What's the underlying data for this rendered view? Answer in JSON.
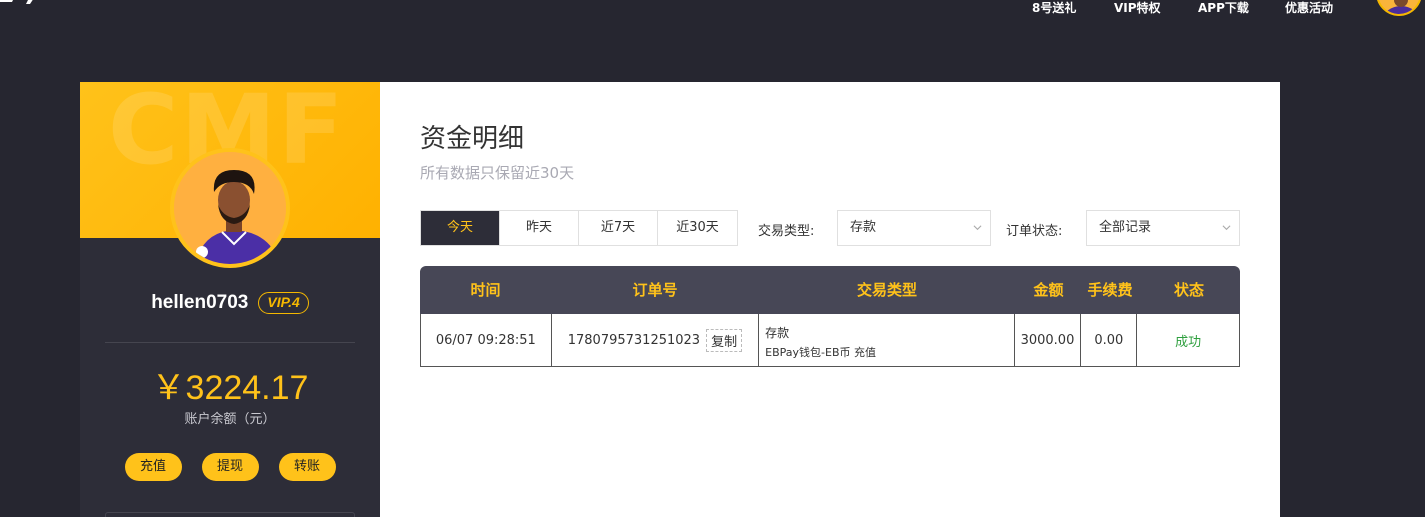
{
  "nav": {
    "items": [
      "8号送礼",
      "VIP特权",
      "APP下载",
      "优惠活动"
    ]
  },
  "profile": {
    "banner_text": "CMF",
    "username": "hellen0703",
    "vip_label": "VIP.4",
    "balance": "￥3224.17",
    "balance_label": "账户余额（元）",
    "buttons": [
      "充值",
      "提现",
      "转账"
    ]
  },
  "main": {
    "title": "资金明细",
    "subtitle": "所有数据只保留近30天",
    "date_tabs": [
      {
        "label": "今天",
        "active": true
      },
      {
        "label": "昨天",
        "active": false
      },
      {
        "label": "近7天",
        "active": false
      },
      {
        "label": "近30天",
        "active": false
      }
    ],
    "filter_type_label": "交易类型:",
    "filter_type_value": "存款",
    "filter_status_label": "订单状态:",
    "filter_status_value": "全部记录"
  },
  "table": {
    "headers": [
      "时间",
      "订单号",
      "交易类型",
      "金额",
      "手续费",
      "状态"
    ],
    "rows": [
      {
        "time": "06/07 09:28:51",
        "order_no": "1780795731251023",
        "copy_label": "复制",
        "type_main": "存款",
        "type_sub": "EBPay钱包-EB币 充值",
        "amount": "3000.00",
        "fee": "0.00",
        "status": "成功"
      }
    ]
  },
  "colors": {
    "accent": "#ffc21a",
    "dark_bg": "#262630",
    "panel_bg": "#2d2d38",
    "success": "#2e9f3e"
  }
}
